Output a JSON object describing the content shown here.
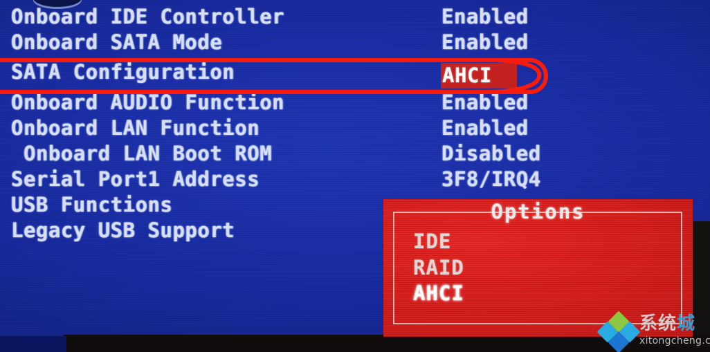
{
  "screen": {
    "background_color": "#17299f",
    "text_color": "#d8dff5",
    "accent_color": "#f91c0d",
    "selection_color": "#c32020"
  },
  "bios_menu": {
    "rows": [
      {
        "label": "Onboard IDE Controller",
        "value": "Enabled",
        "indent": false,
        "selected": false
      },
      {
        "label": "Onboard SATA Mode",
        "value": "Enabled",
        "indent": false,
        "selected": false
      },
      {
        "label": "SATA Configuration",
        "value": "AHCI",
        "indent": false,
        "selected": true
      },
      {
        "label": "Onboard AUDIO Function",
        "value": "Enabled",
        "indent": false,
        "selected": false
      },
      {
        "label": "Onboard LAN Function",
        "value": "Enabled",
        "indent": false,
        "selected": false
      },
      {
        "label": "Onboard LAN Boot ROM",
        "value": "Disabled",
        "indent": true,
        "selected": false
      },
      {
        "label": "Serial Port1 Address",
        "value": "3F8/IRQ4",
        "indent": false,
        "selected": false
      },
      {
        "label": "USB Functions",
        "value": "",
        "indent": false,
        "selected": false
      },
      {
        "label": "Legacy USB Support",
        "value": "",
        "indent": false,
        "selected": false
      }
    ]
  },
  "options_popup": {
    "title": "Options",
    "items": [
      {
        "label": "IDE",
        "current": false
      },
      {
        "label": "RAID",
        "current": false
      },
      {
        "label": "AHCI",
        "current": true
      }
    ]
  },
  "annotation": {
    "shape": "red-rounded-rectangle-highlight",
    "targets": "SATA Configuration / AHCI"
  },
  "watermark": {
    "brand_cn_part1": "系统",
    "brand_cn_part2": "城",
    "url": "xitongcheng.com",
    "logo_colors": [
      "#8dc63f",
      "#29abe2",
      "#29abe2",
      "#1b76d1"
    ]
  }
}
